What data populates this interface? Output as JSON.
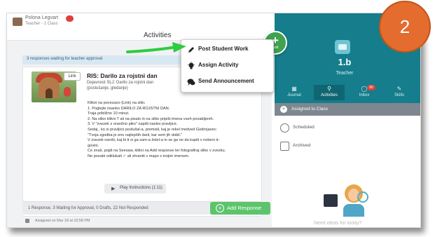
{
  "header": {
    "user_name": "Polona Legvart",
    "user_class": "Teacher - 1 Class",
    "page_title": "Activities"
  },
  "banner": {
    "text": "3 responses waiting for teacher approval"
  },
  "activity": {
    "link_label": "Link",
    "title": "RIS: Darilo za rojstni dan",
    "sub_line1": "Dejavnost SLJ: Darilo za rojstni dan",
    "sub_line2": "(poslušanje, gledanje)",
    "instructions": [
      "Klikni na povezavo (Link) na sliki.",
      "1. Poglejte risanko DARILO ZA ROJSTNI DAN.",
      "Traja približno 10 minut.",
      "2. Na sliko klikni T ali na pisalo in na sliko pripiši imena vseh povabljenih.",
      "3. V \"zvezek z oranžno piko\" napiši naslov pravljice.",
      "Sedaj , ko si pravljico poslušal-a, premisli, kaj je rekel medved Godrnjavec:",
      "\"Tvoja zgodba je eno najlepših daril, kar sem jih dobil.\"",
      "V zvezek naniši, kaj bi ti si ga sam-a želel-a in se ga ne da kupiti v nobeni tr-",
      "govini.",
      "Če znaš, pojdi na Seesaw, klikni na Add response ter fotografiraj sliko v zvezku.",
      "Ne pozabi odklukati ✓ ali shraniti v mapo s tvojim imenom."
    ],
    "play_label": "Play Instructions (1:11)",
    "status_text": "1 Response, 3 Waiting for Approval, 0 Drafts, 22 Not Responded",
    "add_response_label": "Add Response",
    "assigned_on": "Assigned on Mar 18 at 10:58 PM"
  },
  "add_button": {
    "plus": "+",
    "label": "Add"
  },
  "menu": {
    "items": [
      {
        "label": "Post Student Work",
        "icon": "pencil-icon"
      },
      {
        "label": "Assign Activity",
        "icon": "lightbulb-icon"
      },
      {
        "label": "Send Announcement",
        "icon": "chat-bubbles-icon"
      }
    ]
  },
  "class_panel": {
    "class_name": "1.b",
    "role": "Teacher",
    "tabs": [
      {
        "label": "Journal",
        "icon": "book-icon"
      },
      {
        "label": "Activities",
        "icon": "lightbulb-icon"
      },
      {
        "label": "Inbox",
        "icon": "chat-icon",
        "badge": "80"
      },
      {
        "label": "Skills",
        "icon": "skills-icon"
      }
    ],
    "assigned_to_class": "Assigned to Class",
    "scheduled": "Scheduled",
    "archived": "Archived",
    "faded_text": "Need ideas for today?"
  },
  "step_badge": {
    "number": "2"
  },
  "colors": {
    "teal": "#157d8c",
    "green": "#5cc46a",
    "orange_badge": "#e36c2e",
    "arrow": "#2ecc40"
  }
}
